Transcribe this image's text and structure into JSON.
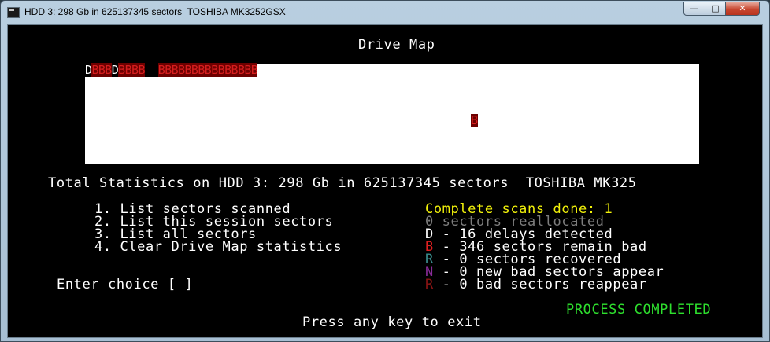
{
  "window": {
    "title": "HDD 3: 298 Gb in 625137345 sectors  TOSHIBA MK3252GSX",
    "controls": {
      "minimize": "—",
      "maximize": "□",
      "close": "✕"
    }
  },
  "console": {
    "heading": "Drive Map",
    "map_row_blocks": [
      {
        "ch": "D",
        "kind": "d"
      },
      {
        "ch": "BBB",
        "kind": "b"
      },
      {
        "ch": "D",
        "kind": "d"
      },
      {
        "ch": "BBBB",
        "kind": "b"
      },
      {
        "ch": "  ",
        "kind": "gap"
      },
      {
        "ch": "BBBBBBBBBBBBBBB",
        "kind": "b"
      }
    ],
    "map_single_block": "B",
    "total_stats": "Total Statistics on HDD 3: 298 Gb in 625137345 sectors  TOSHIBA MK325",
    "menu": [
      "1. List sectors scanned",
      "2. List this session sectors",
      "3. List all sectors",
      "4. Clear Drive Map statistics"
    ],
    "prompt": "Enter choice [ ]",
    "scans_done": "Complete scans done: 1",
    "stats": [
      {
        "code": "0",
        "text": " sectors reallocated"
      },
      {
        "code": "D",
        "text": " - 16 delays detected"
      },
      {
        "code": "B",
        "text": " - 346 sectors remain bad"
      },
      {
        "code": "R",
        "text": " - 0 sectors recovered"
      },
      {
        "code": "N",
        "text": " - 0 new bad sectors appear"
      },
      {
        "code": "R",
        "text": " - 0 bad sectors reappear"
      }
    ],
    "status": "PROCESS COMPLETED",
    "exit_hint": "Press any key to exit",
    "colors": {
      "background": "#000000",
      "map_background": "#ffffff",
      "bad": "#d71e1e",
      "scans_done": "#f2f20a",
      "status": "#2ee02e"
    }
  }
}
